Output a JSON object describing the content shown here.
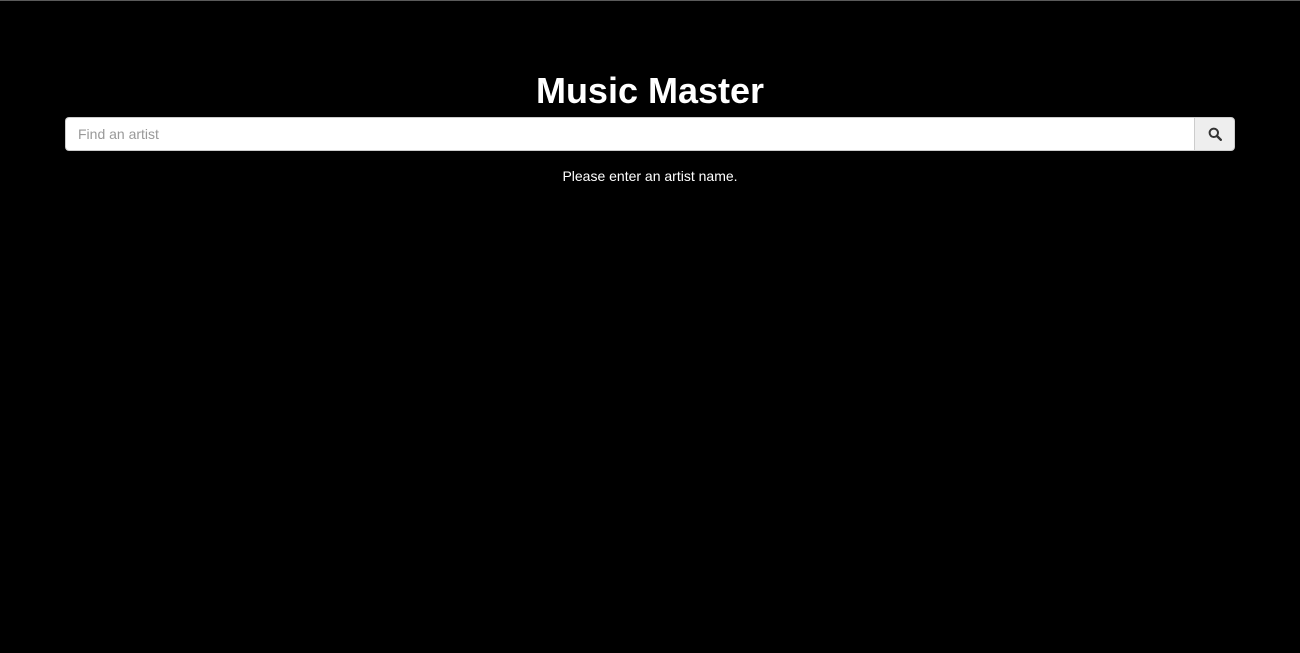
{
  "app": {
    "title": "Music Master"
  },
  "search": {
    "placeholder": "Find an artist",
    "value": "",
    "button_icon": "search-icon"
  },
  "status": {
    "message": "Please enter an artist name."
  },
  "colors": {
    "background": "#000000",
    "text": "#ffffff",
    "input_background": "#ffffff",
    "button_background": "#eeeeee"
  }
}
